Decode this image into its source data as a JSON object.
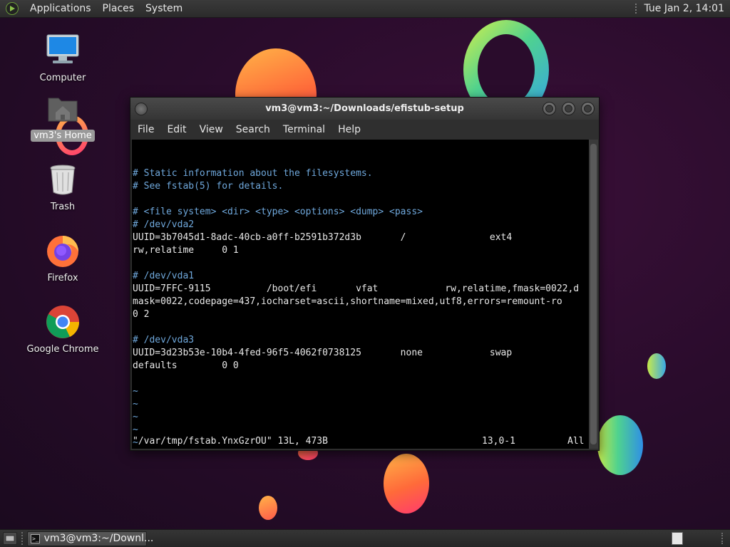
{
  "top_panel": {
    "menus": [
      "Applications",
      "Places",
      "System"
    ],
    "clock": "Tue Jan  2, 14:01"
  },
  "desktop_icons": [
    {
      "label": "Computer",
      "icon": "computer-icon"
    },
    {
      "label": "vm3's Home",
      "icon": "home-folder-icon",
      "selected": true
    },
    {
      "label": "Trash",
      "icon": "trash-icon"
    },
    {
      "label": "Firefox",
      "icon": "firefox-icon"
    },
    {
      "label": "Google Chrome",
      "icon": "chrome-icon"
    }
  ],
  "terminal": {
    "title": "vm3@vm3:~/Downloads/efistub-setup",
    "menus": [
      "File",
      "Edit",
      "View",
      "Search",
      "Terminal",
      "Help"
    ],
    "lines": [
      {
        "text": "# Static information about the filesystems.",
        "kind": "comment"
      },
      {
        "text": "# See fstab(5) for details.",
        "kind": "comment"
      },
      {
        "text": "",
        "kind": "text"
      },
      {
        "text": "# <file system> <dir> <type> <options> <dump> <pass>",
        "kind": "comment"
      },
      {
        "text": "# /dev/vda2",
        "kind": "comment"
      },
      {
        "text": "UUID=3b7045d1-8adc-40cb-a0ff-b2591b372d3b       /               ext4",
        "kind": "text"
      },
      {
        "text": "rw,relatime     0 1",
        "kind": "text"
      },
      {
        "text": "",
        "kind": "text"
      },
      {
        "text": "# /dev/vda1",
        "kind": "comment"
      },
      {
        "text": "UUID=7FFC-9115          /boot/efi       vfat            rw,relatime,fmask=0022,d",
        "kind": "text"
      },
      {
        "text": "mask=0022,codepage=437,iocharset=ascii,shortname=mixed,utf8,errors=remount-ro",
        "kind": "text"
      },
      {
        "text": "0 2",
        "kind": "text"
      },
      {
        "text": "",
        "kind": "text"
      },
      {
        "text": "# /dev/vda3",
        "kind": "comment"
      },
      {
        "text": "UUID=3d23b53e-10b4-4fed-96f5-4062f0738125       none            swap",
        "kind": "text"
      },
      {
        "text": "defaults        0 0",
        "kind": "text"
      },
      {
        "text": "",
        "kind": "text"
      },
      {
        "text": "~",
        "kind": "tilde"
      },
      {
        "text": "~",
        "kind": "tilde"
      },
      {
        "text": "~",
        "kind": "tilde"
      },
      {
        "text": "~",
        "kind": "tilde"
      },
      {
        "text": "~",
        "kind": "tilde"
      },
      {
        "text": "~",
        "kind": "tilde"
      }
    ],
    "status": {
      "file": "\"/var/tmp/fstab.YnxGzrOU\" 13L, 473B",
      "position": "13,0-1",
      "scroll": "All"
    }
  },
  "taskbar": {
    "window_button": "vm3@vm3:~/Downl..."
  }
}
